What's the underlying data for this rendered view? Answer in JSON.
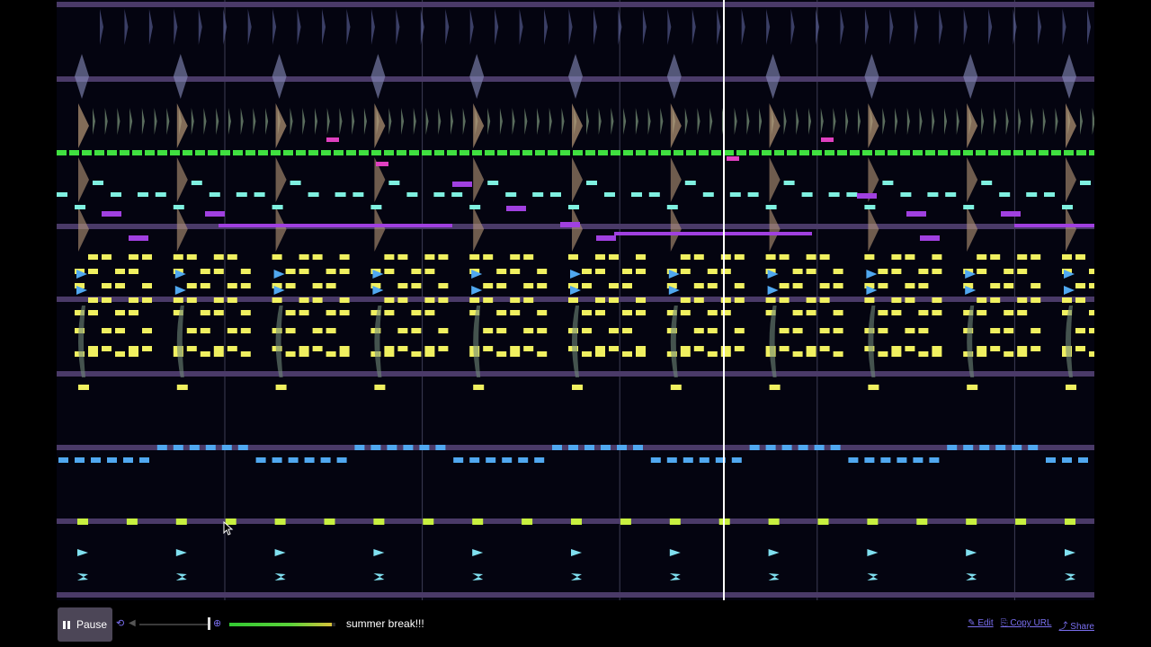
{
  "player": {
    "pause_label": "Pause",
    "song_title": "summer break!!!",
    "progress": 0.97,
    "volume": 0.98,
    "links": {
      "edit": "✎ Edit",
      "copy_url": "⎘ Copy URL",
      "share": "⤴ Share"
    }
  },
  "icons": {
    "pause": "pause-icon",
    "loop": "loop-icon",
    "volume": "volume-icon",
    "zoom": "zoom-icon"
  },
  "colors": {
    "background": "#040410",
    "channel_divider": "#4a3a68",
    "playhead": "#ffffff",
    "bar_line": "#3d3d55",
    "accent_link": "#7a6ff0",
    "pitch_green": "#40e040",
    "pitch_cyan": "#7ff0e0",
    "pitch_magenta": "#e040c0",
    "pitch_purple": "#a040e0",
    "pitch_yellow": "#f0f060",
    "pitch_blue": "#50a8f0",
    "noise_lime": "#c8f040",
    "noise_cyan": "#80e0f0"
  },
  "song": {
    "bars_visible": 10,
    "playhead_bar_fraction": 0.486
  }
}
